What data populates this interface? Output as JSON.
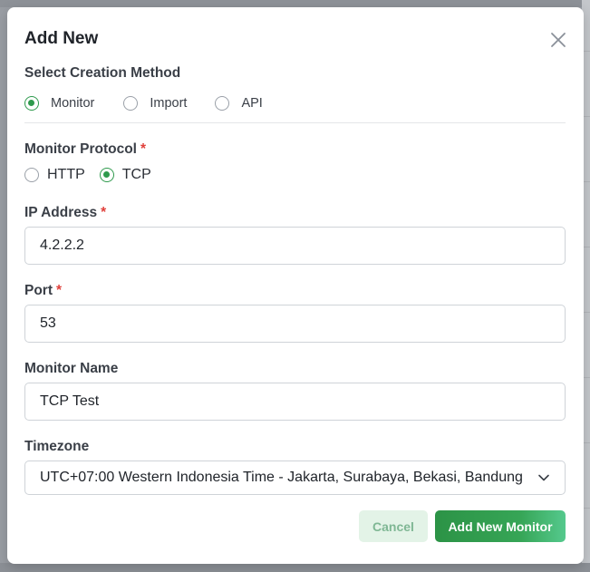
{
  "modal": {
    "title": "Add New",
    "close_icon": "close-icon"
  },
  "creation_method": {
    "label": "Select Creation Method",
    "options": [
      {
        "label": "Monitor",
        "selected": true
      },
      {
        "label": "Import",
        "selected": false
      },
      {
        "label": "API",
        "selected": false
      }
    ]
  },
  "protocol": {
    "label": "Monitor Protocol",
    "required_mark": "*",
    "options": [
      {
        "label": "HTTP",
        "selected": false
      },
      {
        "label": "TCP",
        "selected": true
      }
    ]
  },
  "ip_address": {
    "label": "IP Address",
    "required_mark": "*",
    "value": "4.2.2.2"
  },
  "port": {
    "label": "Port",
    "required_mark": "*",
    "value": "53"
  },
  "monitor_name": {
    "label": "Monitor Name",
    "value": "TCP Test"
  },
  "timezone": {
    "label": "Timezone",
    "value": "UTC+07:00 Western Indonesia Time - Jakarta, Surabaya, Bekasi, Bandung",
    "icon": "chevron-down-icon"
  },
  "actions": {
    "cancel_label": "Cancel",
    "submit_label": "Add New Monitor"
  },
  "colors": {
    "accent": "#2f9a4d",
    "required": "#e0403b",
    "cancel_bg": "#e3f3e7",
    "cancel_text": "#7fb794"
  }
}
